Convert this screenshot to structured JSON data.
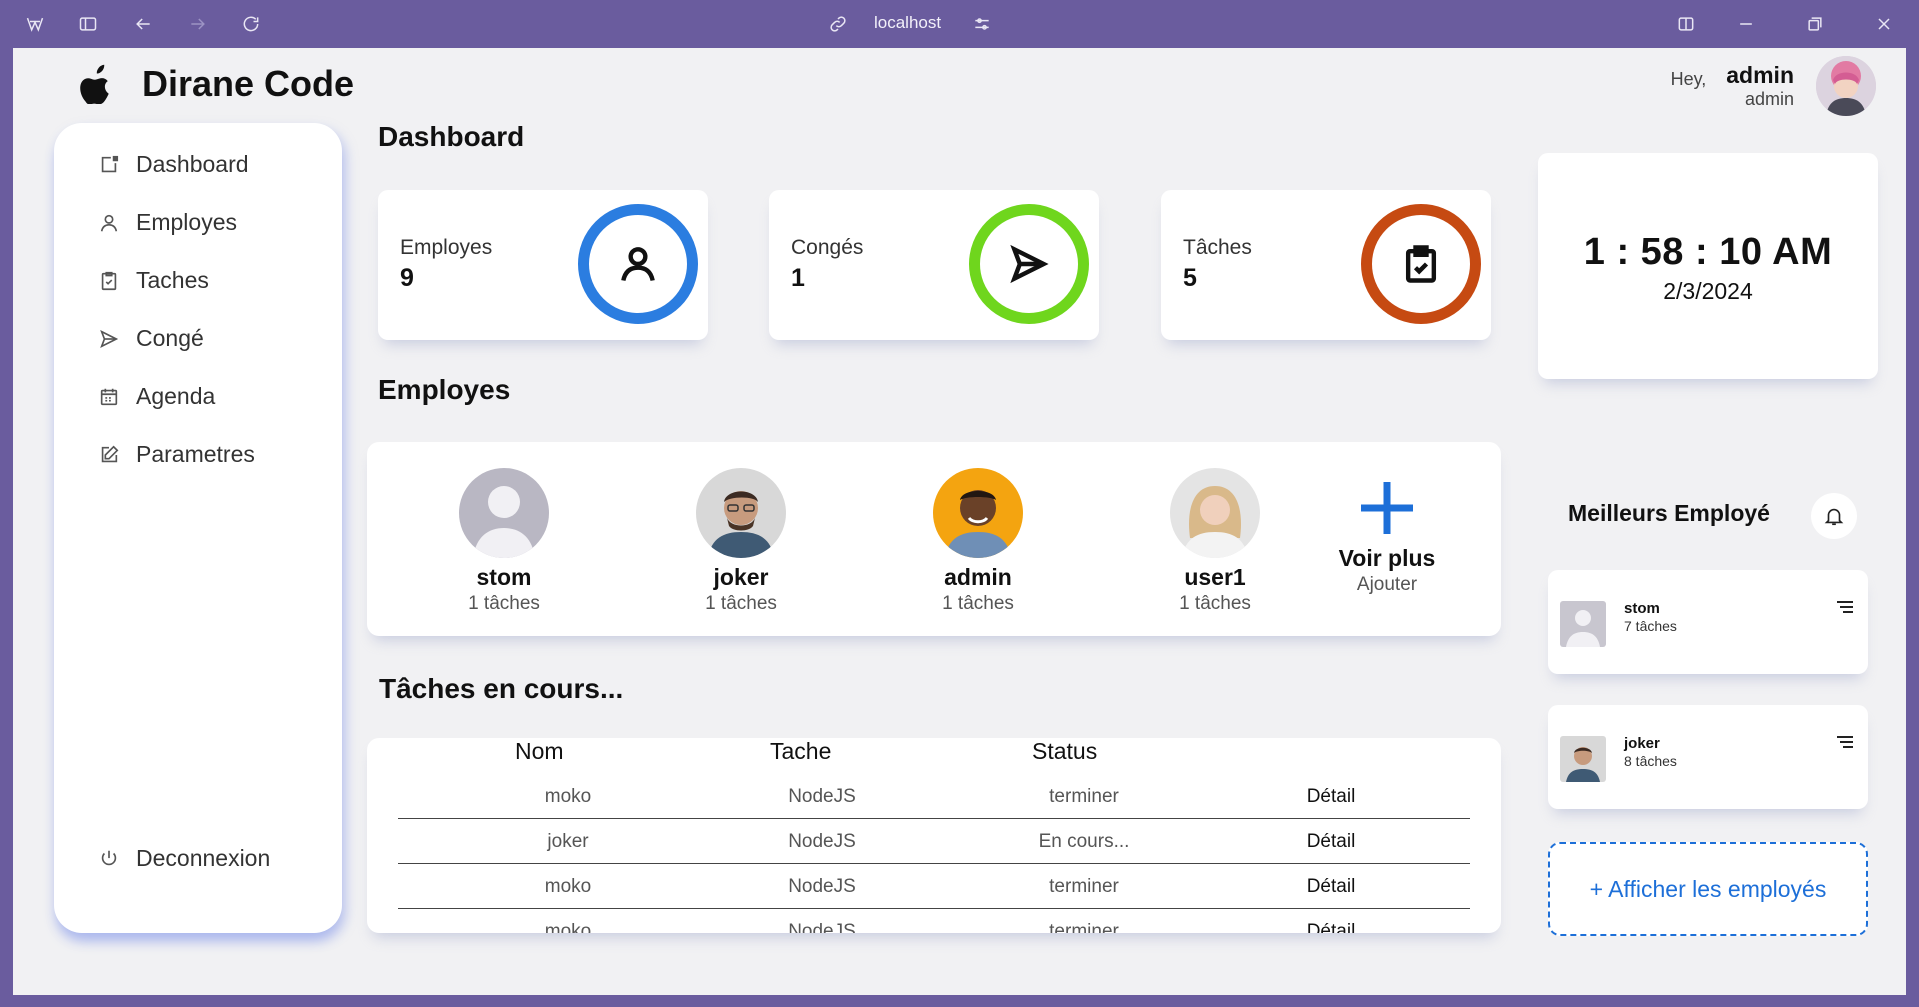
{
  "browser": {
    "url": "localhost"
  },
  "app": {
    "brand": "Dirane Code",
    "greeting": "Hey,",
    "user_name": "admin",
    "user_role": "admin"
  },
  "sidebar": {
    "items": [
      {
        "label": "Dashboard",
        "icon": "dashboard-icon"
      },
      {
        "label": "Employes",
        "icon": "user-icon"
      },
      {
        "label": "Taches",
        "icon": "clipboard-icon"
      },
      {
        "label": "Congé",
        "icon": "send-icon"
      },
      {
        "label": "Agenda",
        "icon": "calendar-icon"
      },
      {
        "label": "Parametres",
        "icon": "edit-icon"
      }
    ],
    "logout": "Deconnexion"
  },
  "dashboard": {
    "title": "Dashboard",
    "stats": [
      {
        "label": "Employes",
        "value": "9",
        "color": "#2b7de0",
        "icon": "user-icon"
      },
      {
        "label": "Congés",
        "value": "1",
        "color": "#6fd61d",
        "icon": "send-icon"
      },
      {
        "label": "Tâches",
        "value": "5",
        "color": "#c64a12",
        "icon": "clipboard-check-icon"
      }
    ]
  },
  "clock": {
    "time": "1 : 58 : 10 AM",
    "date": "2/3/2024"
  },
  "employees": {
    "title": "Employes",
    "list": [
      {
        "name": "stom",
        "tasks": "1 tâches"
      },
      {
        "name": "joker",
        "tasks": "1 tâches"
      },
      {
        "name": "admin",
        "tasks": "1 tâches"
      },
      {
        "name": "user1",
        "tasks": "1 tâches"
      }
    ],
    "more_label": "Voir plus",
    "more_sub": "Ajouter"
  },
  "tasks": {
    "title": "Tâches en cours...",
    "headers": [
      "Nom",
      "Tache",
      "Status"
    ],
    "rows": [
      {
        "nom": "moko",
        "tache": "NodeJS",
        "status": "terminer",
        "action": "Détail"
      },
      {
        "nom": "joker",
        "tache": "NodeJS",
        "status": "En cours...",
        "action": "Détail"
      },
      {
        "nom": "moko",
        "tache": "NodeJS",
        "status": "terminer",
        "action": "Détail"
      },
      {
        "nom": "moko",
        "tache": "NodeJS",
        "status": "terminer",
        "action": "Détail"
      }
    ]
  },
  "best": {
    "title": "Meilleurs Employé",
    "list": [
      {
        "name": "stom",
        "tasks": "7 tâches"
      },
      {
        "name": "joker",
        "tasks": "8 tâches"
      }
    ],
    "show_all": "+ Afficher les employés"
  }
}
